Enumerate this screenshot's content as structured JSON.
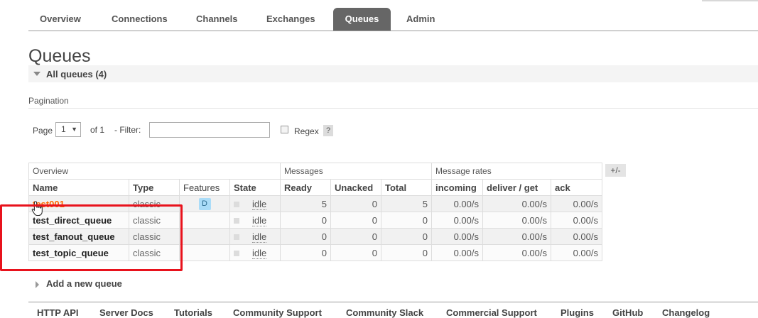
{
  "nav": {
    "tabs": [
      {
        "label": "Overview"
      },
      {
        "label": "Connections"
      },
      {
        "label": "Channels"
      },
      {
        "label": "Exchanges"
      },
      {
        "label": "Queues",
        "active": true
      },
      {
        "label": "Admin"
      }
    ]
  },
  "page": {
    "title": "Queues",
    "section_title": "All queues (4)"
  },
  "pagination": {
    "label": "Pagination",
    "page_label": "Page",
    "page_value": "1",
    "of_label": "of 1",
    "filter_label": "- Filter:",
    "filter_value": "",
    "regex_label": "Regex",
    "help_label": "?"
  },
  "table": {
    "groups": [
      "Overview",
      "Messages",
      "Message rates"
    ],
    "plus_minus": "+/-",
    "columns": [
      "Name",
      "Type",
      "Features",
      "State",
      "Ready",
      "Unacked",
      "Total",
      "incoming",
      "deliver / get",
      "ack"
    ],
    "rows": [
      {
        "name": "test001",
        "type": "classic",
        "feature": "D",
        "state": "idle",
        "ready": "5",
        "unacked": "0",
        "total": "5",
        "incoming": "0.00/s",
        "deliver_get": "0.00/s",
        "ack": "0.00/s"
      },
      {
        "name": "test_direct_queue",
        "type": "classic",
        "feature": "",
        "state": "idle",
        "ready": "0",
        "unacked": "0",
        "total": "0",
        "incoming": "0.00/s",
        "deliver_get": "0.00/s",
        "ack": "0.00/s"
      },
      {
        "name": "test_fanout_queue",
        "type": "classic",
        "feature": "",
        "state": "idle",
        "ready": "0",
        "unacked": "0",
        "total": "0",
        "incoming": "0.00/s",
        "deliver_get": "0.00/s",
        "ack": "0.00/s"
      },
      {
        "name": "test_topic_queue",
        "type": "classic",
        "feature": "",
        "state": "idle",
        "ready": "0",
        "unacked": "0",
        "total": "0",
        "incoming": "0.00/s",
        "deliver_get": "0.00/s",
        "ack": "0.00/s"
      }
    ]
  },
  "add_queue": {
    "label": "Add a new queue"
  },
  "footer": {
    "links": [
      "HTTP API",
      "Server Docs",
      "Tutorials",
      "Community Support",
      "Community Slack",
      "Commercial Support",
      "Plugins",
      "GitHub",
      "Changelog"
    ]
  },
  "colors": {
    "active_tab": "#666666",
    "queue_link": "#ff6600",
    "highlight_box": "#e8121c",
    "badge": "#aadcf8"
  },
  "icons": {
    "section_toggle": "triangle-down-icon",
    "add_toggle": "triangle-right-icon",
    "cursor": "hand-cursor-icon"
  }
}
